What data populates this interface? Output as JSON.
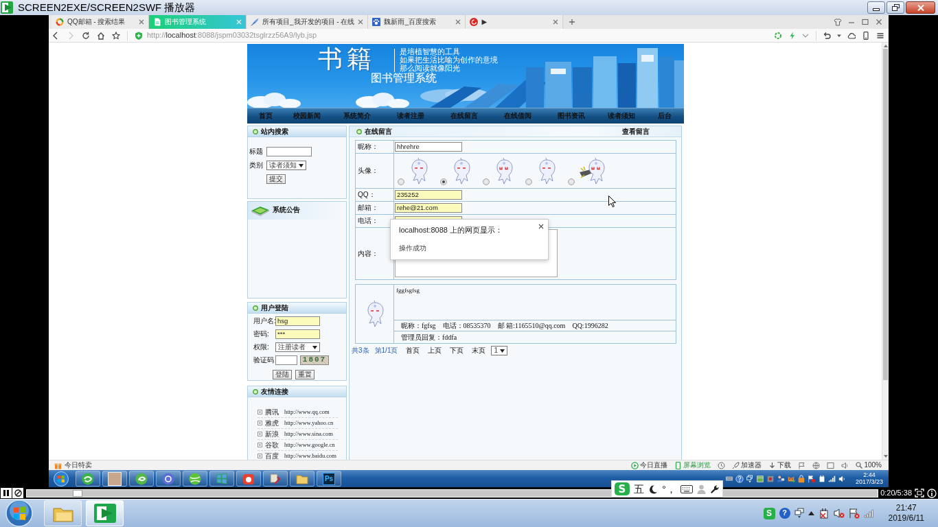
{
  "player_window": {
    "title": "SCREEN2EXE/SCREEN2SWF 播放器"
  },
  "browser": {
    "tabs": [
      {
        "label": "QQ邮箱 - 搜索结果",
        "selected": false
      },
      {
        "label": "图书管理系统",
        "selected": true
      },
      {
        "label": "所有项目_我开发的项目 - 在线",
        "selected": false
      },
      {
        "label": "魏新雨_百度搜索",
        "selected": false
      },
      {
        "label": "▶",
        "selected": false
      }
    ],
    "back_button": {
      "disabled": false
    },
    "forward_button": {
      "disabled": true
    },
    "url": "http://**localhost**:8088/jspm03032tsglrzz56A9/lyb.jsp"
  },
  "site": {
    "banner": {
      "heading": "书籍",
      "slogan": [
        "是培植智慧的工具",
        "如果把生活比喻为创作的意境",
        "那么阅读就像阳光"
      ],
      "title": "图书管理系统"
    },
    "nav": [
      "首页",
      "校园新闻",
      "系统简介",
      "读者注册",
      "在线留言",
      "在线借阅",
      "图书资讯",
      "读者须知",
      "后台"
    ],
    "search_panel": {
      "title": "站内搜索",
      "fields": [
        {
          "label": "标题",
          "kind": "text"
        },
        {
          "label": "类别",
          "kind": "select",
          "value": "读者须知"
        }
      ],
      "button": "提交"
    },
    "notice_panel": {
      "title": "系统公告"
    },
    "login_panel": {
      "title": "用户登陆",
      "fields": [
        {
          "label": "用户名:",
          "kind": "text",
          "value": "hsg",
          "autofilled": true
        },
        {
          "label": "密码:",
          "kind": "text",
          "value": "***",
          "autofilled": true
        },
        {
          "label": "权限:",
          "kind": "select",
          "value": "注册读者"
        },
        {
          "label": "验证码",
          "kind": "captcha",
          "code": "1807"
        }
      ],
      "buttons": [
        "登陆",
        "重置"
      ]
    },
    "links_panel": {
      "title": "友情连接",
      "links": [
        {
          "name": "腾讯",
          "url": "http://www.qq.com"
        },
        {
          "name": "雅虎",
          "url": "http://www.yahoo.cn"
        },
        {
          "name": "新浪",
          "url": "http://www.sina.com"
        },
        {
          "name": "谷歌",
          "url": "http://www.google.cn"
        },
        {
          "name": "百度",
          "url": "http://www.baidu.com"
        }
      ]
    },
    "guestbook": {
      "title": "在线留言",
      "view_link": "查看留言",
      "form": [
        {
          "label": "昵称：",
          "kind": "text",
          "value": "hhrehre",
          "autofilled": false
        },
        {
          "label": "头像：",
          "kind": "avatars",
          "options": [
            {
              "selected": false
            },
            {
              "selected": true
            },
            {
              "selected": false
            },
            {
              "selected": false
            },
            {
              "selected": false
            }
          ]
        },
        {
          "label": "QQ：",
          "kind": "text",
          "value": "235252",
          "autofilled": true
        },
        {
          "label": "邮箱：",
          "kind": "text",
          "value": "rehe@21.com",
          "autofilled": true
        },
        {
          "label": "电话：",
          "kind": "text",
          "autofilled": true
        },
        {
          "label": "内容：",
          "kind": "textarea"
        }
      ],
      "messages": [
        {
          "content": "fggfsgfsg",
          "details": [
            "昵称：fgfsg",
            "电话：08535370",
            "邮 箱:1165510@qq.com",
            "QQ:1996282"
          ],
          "reply": "管理员回复：fddfa"
        }
      ],
      "pagination": {
        "total": "共3条",
        "page": "第1/1页",
        "links": [
          "首页",
          "上页",
          "下页",
          "末页"
        ],
        "select": "1"
      }
    },
    "dialog": {
      "title": "localhost:8088 上的网页显示：",
      "message": "操作成功"
    }
  },
  "status_bar": {
    "left": "今日特卖",
    "items": [
      "今日直播",
      "屏幕浏览",
      "加速器",
      "下载"
    ],
    "zoom": "100%"
  },
  "inner_taskbar": {
    "icon_text": "Ps",
    "time": "2:44",
    "date": "2017/3/23"
  },
  "player": {
    "level": 0.06,
    "time": "0:20/5:38"
  },
  "ime_toolbar": {
    "logo": "S",
    "mode": "五",
    "punctuation": "°，"
  },
  "taskbar": {
    "apps": [
      {
        "selected": false
      },
      {
        "selected": true
      }
    ],
    "tray_logo": "S",
    "help": "?",
    "time": "21:47",
    "date": "2019/6/11"
  }
}
